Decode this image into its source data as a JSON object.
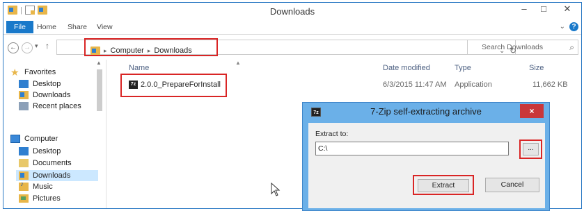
{
  "window": {
    "title": "Downloads",
    "qat_separator": "|",
    "minimize": "–",
    "maximize": "□",
    "close": "✕"
  },
  "ribbon": {
    "tabs": [
      "File",
      "Home",
      "Share",
      "View"
    ],
    "expand": "⌄",
    "help": "?"
  },
  "address": {
    "back": "←",
    "forward": "→",
    "recent": "▾",
    "up": "↑",
    "path": [
      "Computer",
      "Downloads"
    ],
    "separator": "▸",
    "dropdown": "⌄",
    "refresh": "↻",
    "search_placeholder": "Search Downloads",
    "search_icon": "⌕"
  },
  "nav": {
    "favorites_label": "Favorites",
    "favorites": [
      "Desktop",
      "Downloads",
      "Recent places"
    ],
    "computer_label": "Computer",
    "computer": [
      "Desktop",
      "Documents",
      "Downloads",
      "Music",
      "Pictures"
    ],
    "selected": "Downloads",
    "scroll_up": "▲"
  },
  "columns": {
    "name": "Name",
    "date_modified": "Date modified",
    "type": "Type",
    "size": "Size",
    "sort_indicator": "▲"
  },
  "files": [
    {
      "name": "2.0.0_PrepareForInstall",
      "icon_label": "7z",
      "date_modified": "6/3/2015 11:47 AM",
      "type": "Application",
      "size": "11,662 KB"
    }
  ],
  "dialog": {
    "icon_label": "7z",
    "title": "7-Zip self-extracting archive",
    "close": "×",
    "extract_to_label": "Extract to:",
    "extract_to_value": "C:\\",
    "browse_label": "...",
    "extract_label": "Extract",
    "cancel_label": "Cancel"
  },
  "colors": {
    "accent": "#1979ca",
    "highlight_red": "#d92525",
    "dialog_frame": "#6bb0e8",
    "close_red": "#c9373a"
  },
  "icons": {
    "qat": [
      "folder-icon",
      "properties-icon",
      "new-folder-icon"
    ],
    "favorites": "star-icon",
    "computer": "computer-icon",
    "archive": "7zip-icon"
  }
}
